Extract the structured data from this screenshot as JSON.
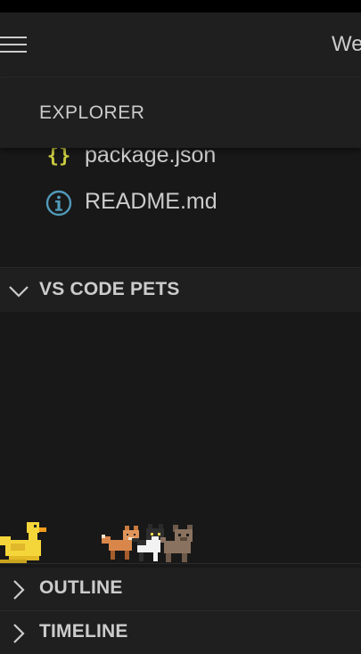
{
  "titlebar": {
    "title": "We",
    "menu_icon": "hamburger-menu-icon"
  },
  "explorer": {
    "title": "EXPLORER",
    "files": [
      {
        "name": "package.json",
        "icon": "json-braces-icon",
        "icon_color": "#cbcb41"
      },
      {
        "name": "README.md",
        "icon": "info-icon",
        "icon_color": "#519aba"
      }
    ]
  },
  "sections": {
    "pets": {
      "label": "VS CODE PETS",
      "expanded": true
    },
    "outline": {
      "label": "OUTLINE",
      "expanded": false
    },
    "timeline": {
      "label": "TIMELINE",
      "expanded": false
    }
  },
  "pets": [
    {
      "kind": "duck",
      "icon": "duck-pet-icon"
    },
    {
      "kind": "fox",
      "icon": "fox-pet-icon"
    },
    {
      "kind": "cat",
      "icon": "cat-pet-icon"
    },
    {
      "kind": "dog",
      "icon": "dog-pet-icon"
    }
  ],
  "colors": {
    "background": "#181818",
    "header": "#1f1f1f",
    "text": "#cccccc",
    "json_icon": "#cbcb41",
    "info_icon": "#519aba"
  }
}
